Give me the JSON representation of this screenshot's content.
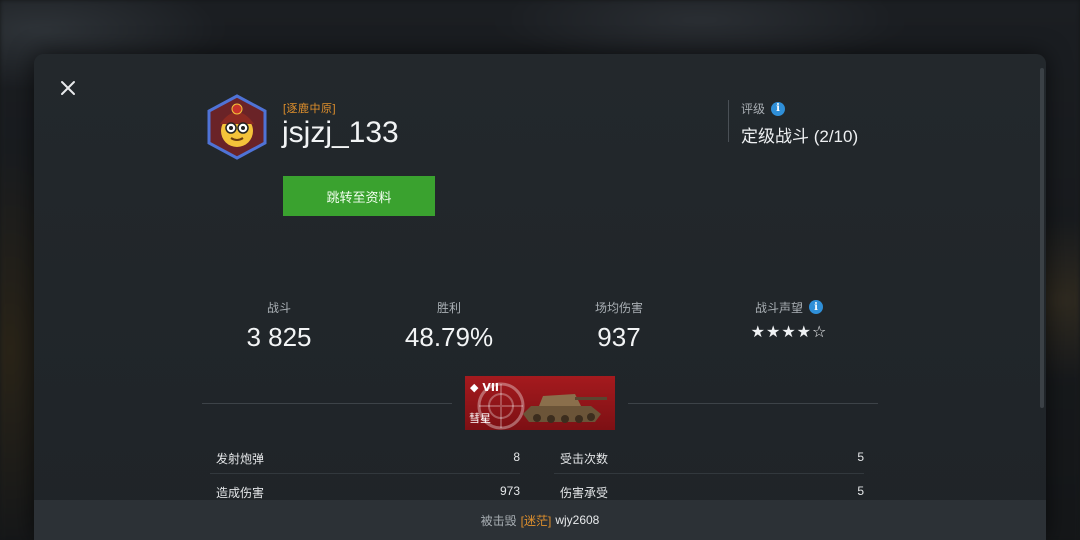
{
  "player": {
    "clan_tag": "[逐鹿中原]",
    "username": "jsjzj_133",
    "profile_button": "跳转至资料"
  },
  "rating": {
    "label": "评级",
    "value": "定级战斗 (2/10)"
  },
  "stats": [
    {
      "label": "战斗",
      "value": "3 825"
    },
    {
      "label": "胜利",
      "value": "48.79%"
    },
    {
      "label": "场均伤害",
      "value": "937"
    },
    {
      "label": "战斗声望",
      "value": "★★★★☆"
    }
  ],
  "tank": {
    "tier": "VII",
    "name": "彗星",
    "card_color": "#a51a1e"
  },
  "battle_stats": {
    "left": [
      {
        "label": "发射炮弹",
        "value": "8"
      },
      {
        "label": "造成伤害",
        "value": "973"
      }
    ],
    "right": [
      {
        "label": "受击次数",
        "value": "5"
      },
      {
        "label": "伤害承受",
        "value": "5"
      }
    ]
  },
  "footer": {
    "prefix": "被击毁",
    "clan": "[迷茫]",
    "killer": "wjy2608"
  },
  "icons": {
    "close": "close-icon",
    "info": "info-icon",
    "tier": "tier-chevron-icon"
  },
  "colors": {
    "accent_green": "#3aa22f",
    "clan_orange": "#e0902c",
    "info_blue": "#2f8fd8"
  }
}
